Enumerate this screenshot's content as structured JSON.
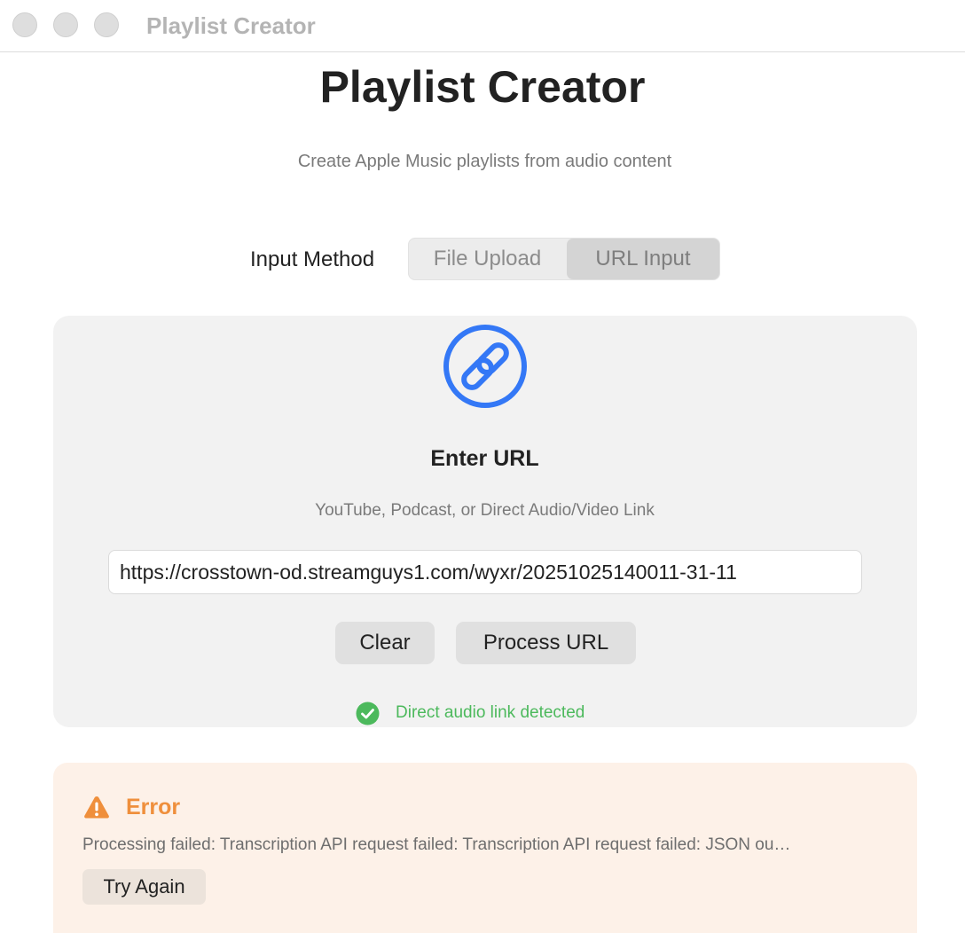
{
  "window": {
    "title": "Playlist Creator"
  },
  "header": {
    "title": "Playlist Creator",
    "subtitle": "Create Apple Music playlists from audio content"
  },
  "input_method": {
    "label": "Input Method",
    "options": [
      {
        "label": "File Upload",
        "selected": false
      },
      {
        "label": "URL Input",
        "selected": true
      }
    ]
  },
  "url_panel": {
    "icon": "link-icon",
    "title": "Enter URL",
    "hint": "YouTube, Podcast, or Direct Audio/Video Link",
    "url_value": "https://crosstown-od.streamguys1.com/wyxr/20251025140011-31-11",
    "clear_label": "Clear",
    "process_label": "Process URL",
    "status_icon": "checkmark-circle-icon",
    "status_text": "Direct audio link detected"
  },
  "error": {
    "icon": "warning-triangle-icon",
    "title": "Error",
    "message": "Processing failed: Transcription API request failed: Transcription API request failed: JSON ou…",
    "retry_label": "Try Again"
  },
  "colors": {
    "accent_blue": "#3478f6",
    "success_green": "#4cb95c",
    "error_orange": "#ef8f3c",
    "error_background": "#fdf1e8"
  }
}
